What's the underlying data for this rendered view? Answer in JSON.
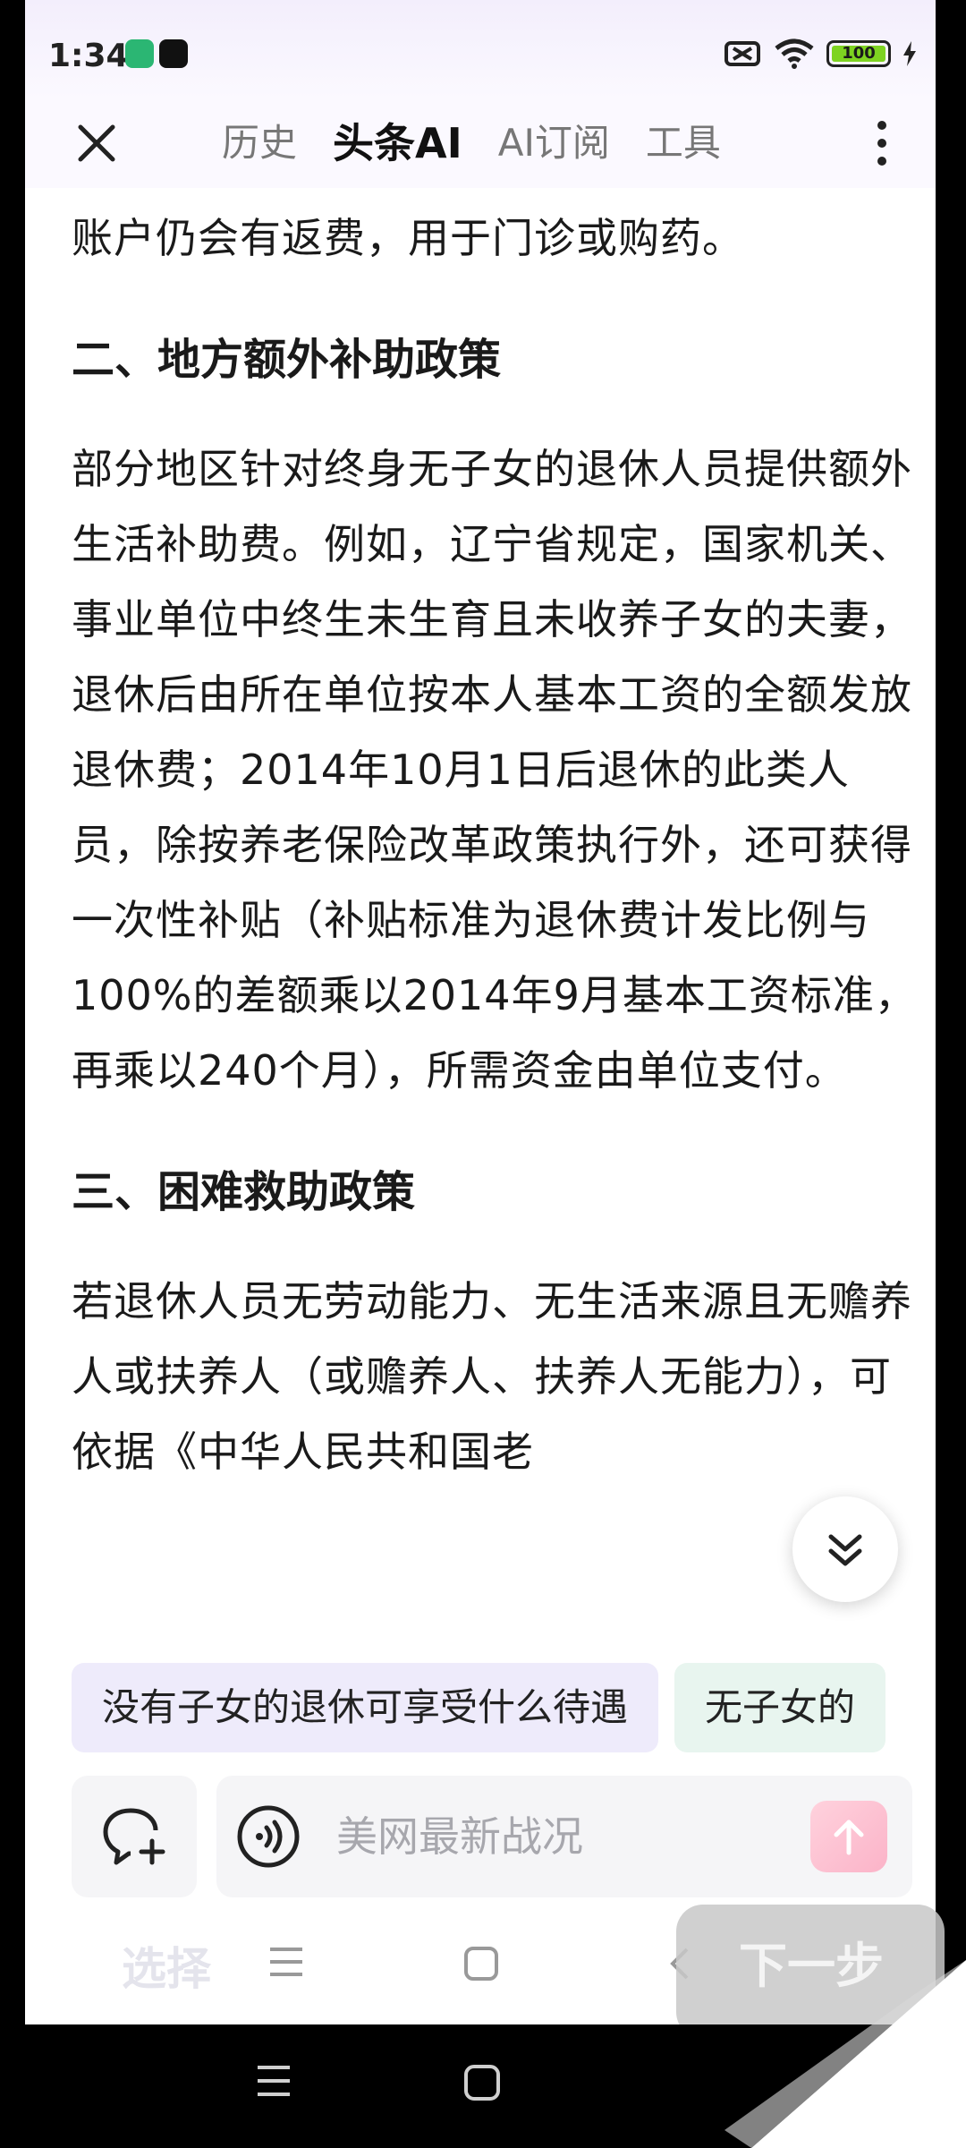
{
  "status_bar": {
    "time": "1:34",
    "battery": "100"
  },
  "header": {
    "tabs": [
      {
        "label": "历史"
      },
      {
        "label": "头条AI"
      },
      {
        "label": "AI订阅"
      },
      {
        "label": "工具"
      }
    ]
  },
  "content": {
    "para_top": "账户仍会有返费，用于门诊或购药。",
    "heading_2": "二、地方额外补助政策",
    "para_2": "部分地区针对终身无子女的退休人员提供额外生活补助费。例如，辽宁省规定，国家机关、事业单位中终生未生育且未收养子女的夫妻，退休后由所在单位按本人基本工资的全额发放退休费；2014年10月1日后退休的此类人员，除按养老保险改革政策执行外，还可获得一次性补贴（补贴标准为退休费计发比例与100%的差额乘以2014年9月基本工资标准，再乘以240个月），所需资金由单位支付。",
    "heading_3": "三、困难救助政策",
    "para_3": "若退休人员无劳动能力、无生活来源且无赡养人或扶养人（或赡养人、扶养人无能力），可依据《中华人民共和国老"
  },
  "suggestions": [
    "没有子女的退休可享受什么待遇",
    "无子女的"
  ],
  "input": {
    "placeholder": "美网最新战况"
  },
  "inner_nav": {
    "select_label": "选择",
    "next_label": "下一步"
  },
  "colors": {
    "accent_chip": "#eeebfb",
    "chip_alt": "#e8f5ef",
    "send_button": "#fbb3c8",
    "battery_fill": "#7ed321"
  }
}
